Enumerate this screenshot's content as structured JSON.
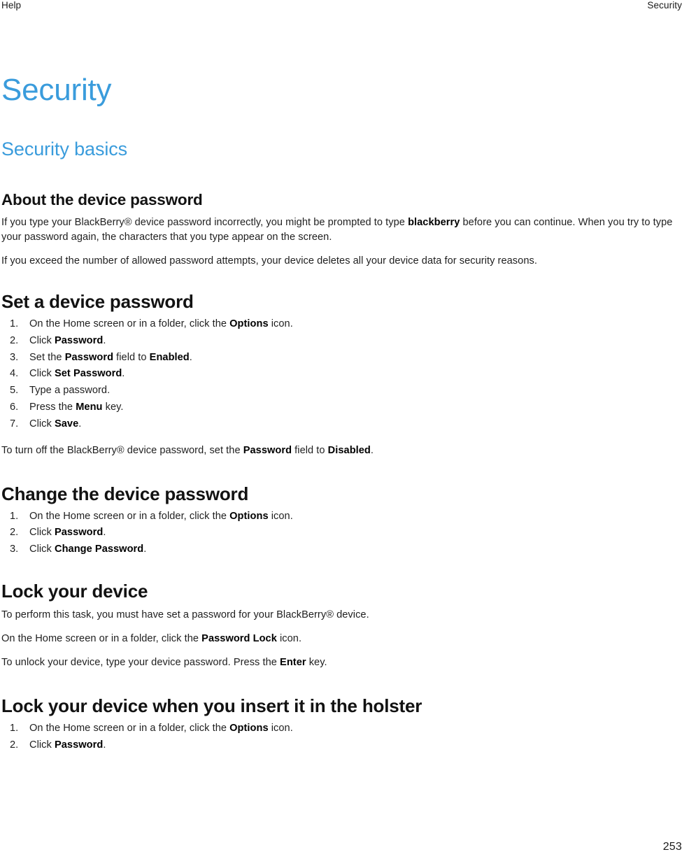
{
  "header": {
    "left": "Help",
    "right": "Security"
  },
  "title": "Security",
  "subtitle": "Security basics",
  "sections": {
    "about": {
      "heading": "About the device password",
      "p1_a": "If you type your BlackBerry® device password incorrectly, you might be prompted to type ",
      "p1_b": "blackberry",
      "p1_c": " before you can continue. When you try to type your password again, the characters that you type appear on the screen.",
      "p2": "If you exceed the number of allowed password attempts, your device deletes all your device data for security reasons."
    },
    "set_password": {
      "heading": "Set a device password",
      "steps": [
        {
          "a": "On the Home screen or in a folder, click the ",
          "b": "Options",
          "c": " icon."
        },
        {
          "a": "Click ",
          "b": "Password",
          "c": "."
        },
        {
          "a": "Set the ",
          "b": "Password",
          "c": " field to ",
          "d": "Enabled",
          "e": "."
        },
        {
          "a": "Click ",
          "b": "Set Password",
          "c": "."
        },
        {
          "a": "Type a password.",
          "b": "",
          "c": ""
        },
        {
          "a": "Press the ",
          "b": "Menu",
          "c": " key."
        },
        {
          "a": "Click ",
          "b": "Save",
          "c": "."
        }
      ],
      "note_a": "To turn off the BlackBerry® device password, set the ",
      "note_b": "Password",
      "note_c": " field to ",
      "note_d": "Disabled",
      "note_e": "."
    },
    "change_password": {
      "heading": "Change the device password",
      "steps": [
        {
          "a": "On the Home screen or in a folder, click the ",
          "b": "Options",
          "c": " icon."
        },
        {
          "a": "Click ",
          "b": "Password",
          "c": "."
        },
        {
          "a": "Click ",
          "b": "Change Password",
          "c": "."
        }
      ]
    },
    "lock_device": {
      "heading": "Lock your device",
      "prereq": "To perform this task, you must have set a password for your BlackBerry® device.",
      "step_a": "On the Home screen or in a folder, click the ",
      "step_b": "Password Lock",
      "step_c": " icon.",
      "after_a": "To unlock your device, type your device password. Press the ",
      "after_b": "Enter",
      "after_c": " key."
    },
    "holster": {
      "heading": "Lock your device when you insert it in the holster",
      "steps": [
        {
          "a": "On the Home screen or in a folder, click the ",
          "b": "Options",
          "c": " icon."
        },
        {
          "a": "Click ",
          "b": "Password",
          "c": "."
        }
      ]
    }
  },
  "page_number": "253"
}
